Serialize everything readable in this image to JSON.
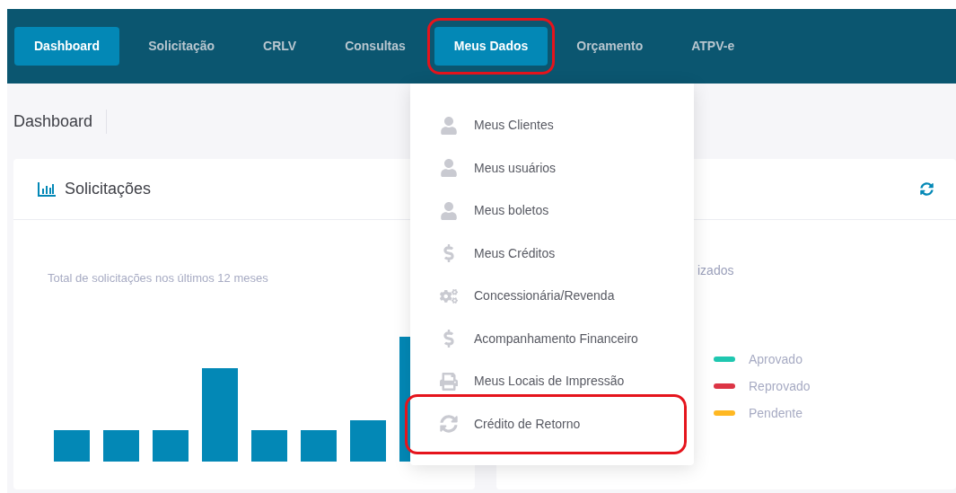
{
  "nav": {
    "tabs": [
      {
        "label": "Dashboard",
        "selected": true,
        "highlighted": false
      },
      {
        "label": "Solicitação",
        "selected": false,
        "highlighted": false
      },
      {
        "label": "CRLV",
        "selected": false,
        "highlighted": false
      },
      {
        "label": "Consultas",
        "selected": false,
        "highlighted": false
      },
      {
        "label": "Meus Dados",
        "selected": true,
        "highlighted": true
      },
      {
        "label": "Orçamento",
        "selected": false,
        "highlighted": false
      },
      {
        "label": "ATPV-e",
        "selected": false,
        "highlighted": false
      }
    ]
  },
  "page_title": "Dashboard",
  "card_requests": {
    "title": "Solicitações",
    "subtitle": "Total de solicitações nos últimos 12 meses"
  },
  "card_right": {
    "subtitle": "izados",
    "legend": [
      {
        "label": "Aprovado",
        "color": "#1fc7b0"
      },
      {
        "label": "Reprovado",
        "color": "#dc3545"
      },
      {
        "label": "Pendente",
        "color": "#ffb822"
      }
    ]
  },
  "dropdown": {
    "items": [
      {
        "label": "Meus Clientes",
        "kind": "user",
        "highlighted": false
      },
      {
        "label": "Meus usuários",
        "kind": "user",
        "highlighted": false
      },
      {
        "label": "Meus boletos",
        "kind": "user",
        "highlighted": false
      },
      {
        "label": "Meus Créditos",
        "kind": "dollar",
        "highlighted": false
      },
      {
        "label": "Concessionária/Revenda",
        "kind": "gears",
        "highlighted": false
      },
      {
        "label": "Acompanhamento Financeiro",
        "kind": "dollar",
        "highlighted": false
      },
      {
        "label": "Meus Locais de Impressão",
        "kind": "print",
        "highlighted": false
      },
      {
        "label": "Crédito de Retorno",
        "kind": "refresh",
        "highlighted": true
      }
    ]
  }
}
